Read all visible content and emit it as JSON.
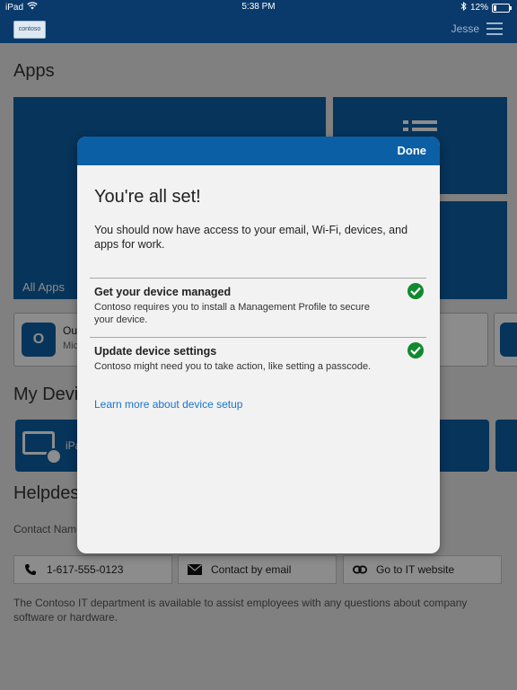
{
  "status_bar": {
    "device": "iPad",
    "time": "5:38 PM",
    "battery": "12%"
  },
  "header": {
    "logo_text": "contoso",
    "user_name": "Jesse"
  },
  "background": {
    "apps_title": "Apps",
    "all_apps_label": "All Apps",
    "outlook_name": "Out",
    "outlook_publisher": "Mic",
    "devices_title": "My Devi",
    "device_tile_label": "iPa",
    "helpdesk_title": "Helpdes",
    "contact_name_label": "Contact Nam",
    "contact_buttons": [
      {
        "label": "1-617-555-0123",
        "icon": "phone-icon"
      },
      {
        "label": "Contact by email",
        "icon": "mail-icon"
      },
      {
        "label": "Go to IT website",
        "icon": "link-icon"
      }
    ],
    "helpdesk_note": "The Contoso IT department is available to assist employees with any questions about company software or hardware."
  },
  "modal": {
    "done_label": "Done",
    "title": "You're all set!",
    "intro": "You should now have access to your email, Wi-Fi, devices, and apps for work.",
    "items": [
      {
        "title": "Get your device managed",
        "description": "Contoso requires you to install a Management Profile to secure your device.",
        "status_icon": "check-circle-icon"
      },
      {
        "title": "Update device settings",
        "description": "Contoso might need you to take action, like setting a passcode.",
        "status_icon": "check-circle-icon"
      }
    ],
    "learn_more_label": "Learn more about device setup"
  },
  "colors": {
    "header_blue": "#0a3a6b",
    "accent_blue": "#0b5fa5",
    "link_blue": "#1a73c8",
    "success_green": "#0f8a2e"
  }
}
